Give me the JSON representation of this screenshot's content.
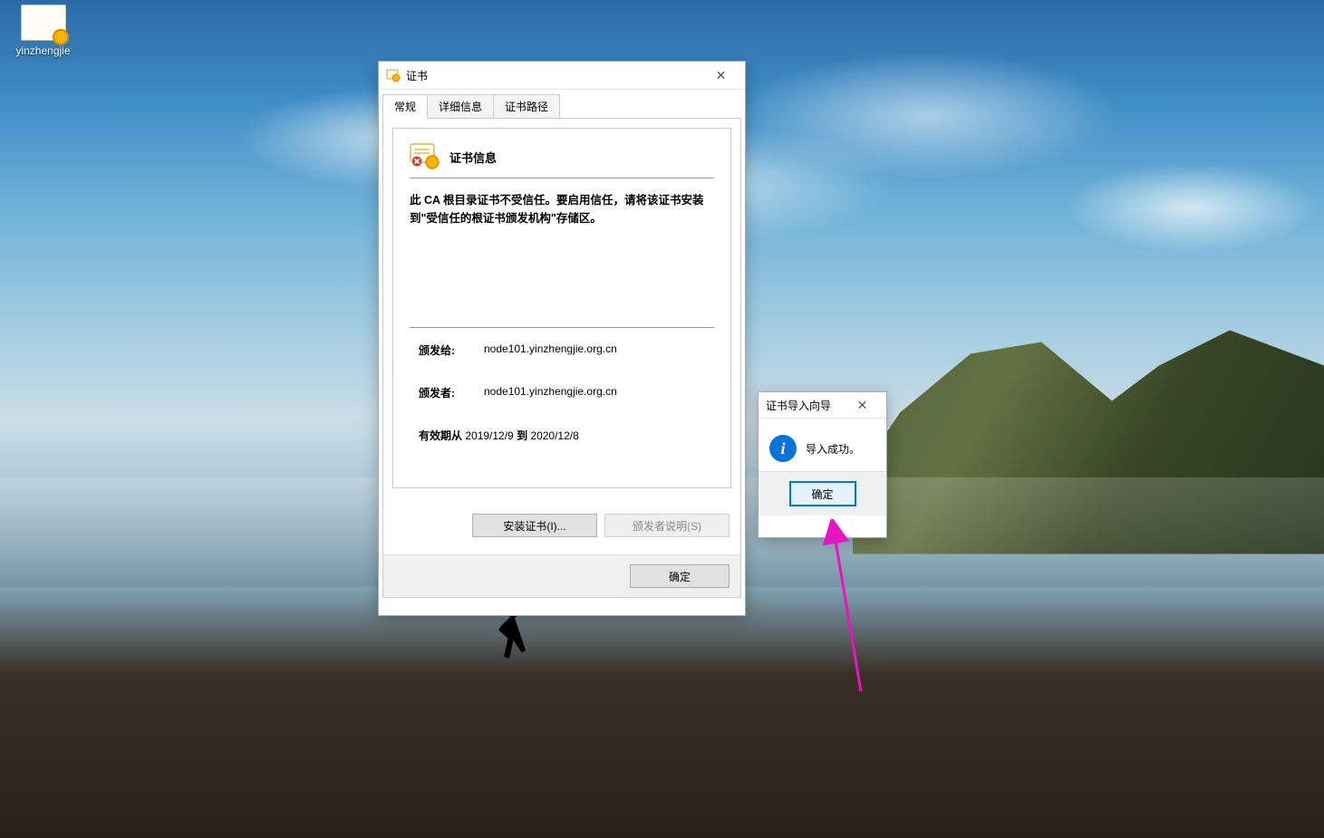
{
  "desktop_icon": {
    "label": "yinzhengjie"
  },
  "cert_window": {
    "title": "证书",
    "tabs": {
      "general": "常规",
      "details": "详细信息",
      "path": "证书路径"
    },
    "info_heading": "证书信息",
    "trust_message": "此 CA 根目录证书不受信任。要启用信任，请将该证书安装到\"受信任的根证书颁发机构\"存储区。",
    "issued_to_label": "颁发给:",
    "issued_to_value": "node101.yinzhengjie.org.cn",
    "issued_by_label": "颁发者:",
    "issued_by_value": "node101.yinzhengjie.org.cn",
    "valid_prefix": "有效期从 ",
    "valid_from": "2019/12/9",
    "valid_mid": " 到 ",
    "valid_to": "2020/12/8",
    "install_btn": "安装证书(I)...",
    "issuer_stmt_btn": "颁发者说明(S)",
    "ok_btn": "确定"
  },
  "import_dialog": {
    "title": "证书导入向导",
    "message": "导入成功。",
    "ok_btn": "确定"
  }
}
